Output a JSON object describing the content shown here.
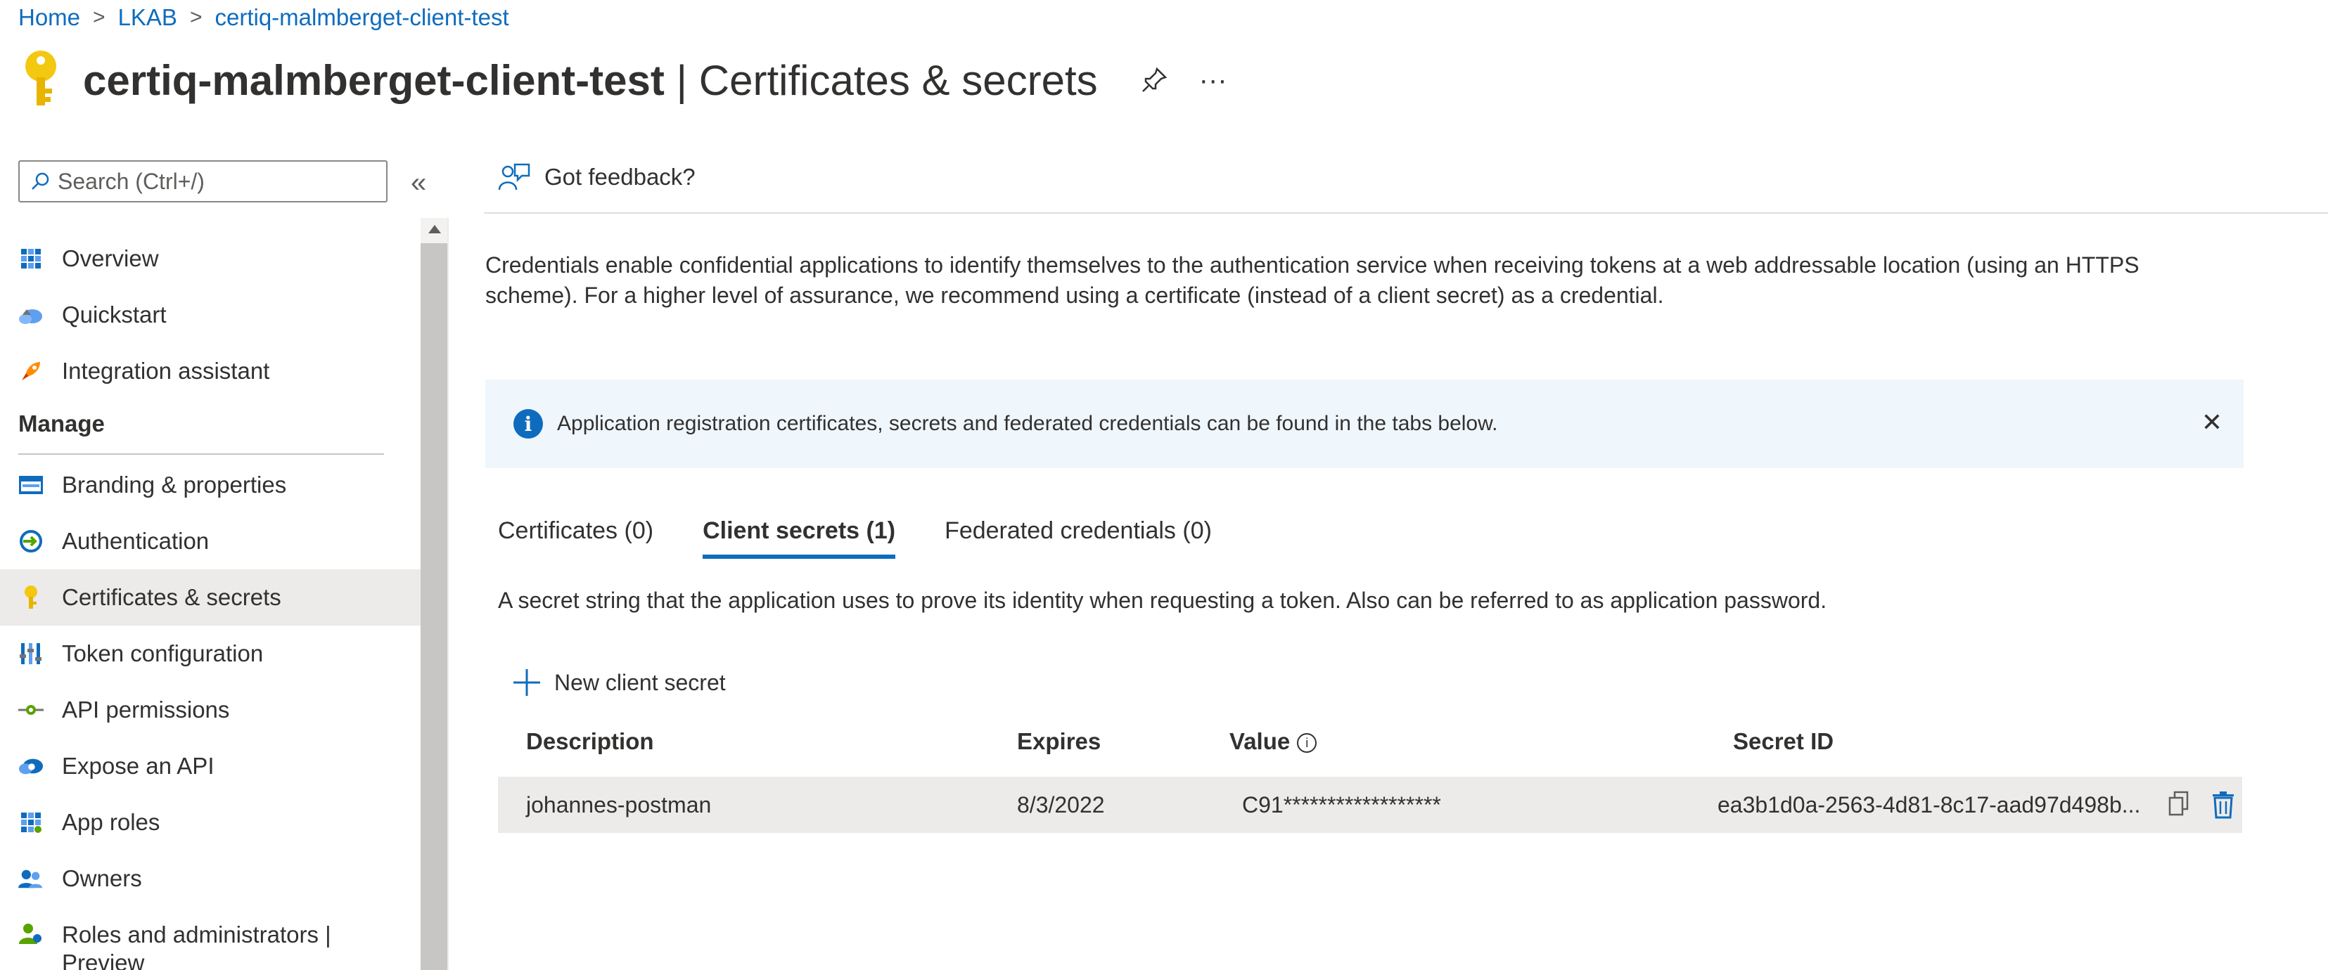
{
  "breadcrumb": {
    "items": [
      "Home",
      "LKAB",
      "certiq-malmberget-client-test"
    ],
    "separator": ">"
  },
  "header": {
    "app_name": "certiq-malmberget-client-test",
    "page_name": "| Certificates & secrets",
    "pin_icon": "pin-icon",
    "more_label": "···"
  },
  "sidebar": {
    "search_placeholder": "Search (Ctrl+/)",
    "collapse_label": "«",
    "top_items": [
      {
        "label": "Overview",
        "icon": "overview-grid-icon"
      },
      {
        "label": "Quickstart",
        "icon": "quickstart-cloud-icon"
      },
      {
        "label": "Integration assistant",
        "icon": "rocket-icon"
      }
    ],
    "manage_title": "Manage",
    "manage_items": [
      {
        "label": "Branding & properties",
        "icon": "branding-icon"
      },
      {
        "label": "Authentication",
        "icon": "authentication-icon"
      },
      {
        "label": "Certificates & secrets",
        "icon": "key-icon",
        "active": true
      },
      {
        "label": "Token configuration",
        "icon": "token-bars-icon"
      },
      {
        "label": "API permissions",
        "icon": "api-permissions-icon"
      },
      {
        "label": "Expose an API",
        "icon": "expose-api-cloud-icon"
      },
      {
        "label": "App roles",
        "icon": "app-roles-grid-icon"
      },
      {
        "label": "Owners",
        "icon": "owners-icon"
      },
      {
        "label": "Roles and administrators | Preview",
        "line1": "Roles and administrators |",
        "line2": "Preview",
        "icon": "roles-admins-icon"
      }
    ]
  },
  "main": {
    "feedback_label": "Got feedback?",
    "description_line1": "Credentials enable confidential applications to identify themselves to the authentication service when receiving tokens at a web addressable location (using an HTTPS",
    "description_line2": "scheme). For a higher level of assurance, we recommend using a certificate (instead of a client secret) as a credential.",
    "info_bar_text": "Application registration certificates, secrets and federated credentials can be found in the tabs below.",
    "info_close": "✕",
    "tabs": [
      {
        "label": "Certificates (0)",
        "active": false
      },
      {
        "label": "Client secrets (1)",
        "active": true
      },
      {
        "label": "Federated credentials (0)",
        "active": false
      }
    ],
    "tab_description": "A secret string that the application uses to prove its identity when requesting a token. Also can be referred to as application password.",
    "new_secret_label": "New client secret",
    "table": {
      "headers": {
        "description": "Description",
        "expires": "Expires",
        "value": "Value",
        "secret_id": "Secret ID"
      },
      "rows": [
        {
          "description": "johannes-postman",
          "expires": "8/3/2022",
          "value": "C91******************",
          "secret_id": "ea3b1d0a-2563-4d81-8c17-aad97d498b..."
        }
      ]
    }
  },
  "colors": {
    "accent": "#0f6cbd",
    "key_gold": "#f2c811",
    "info_bg": "#eff6fc",
    "row_bg": "#edebe9"
  }
}
